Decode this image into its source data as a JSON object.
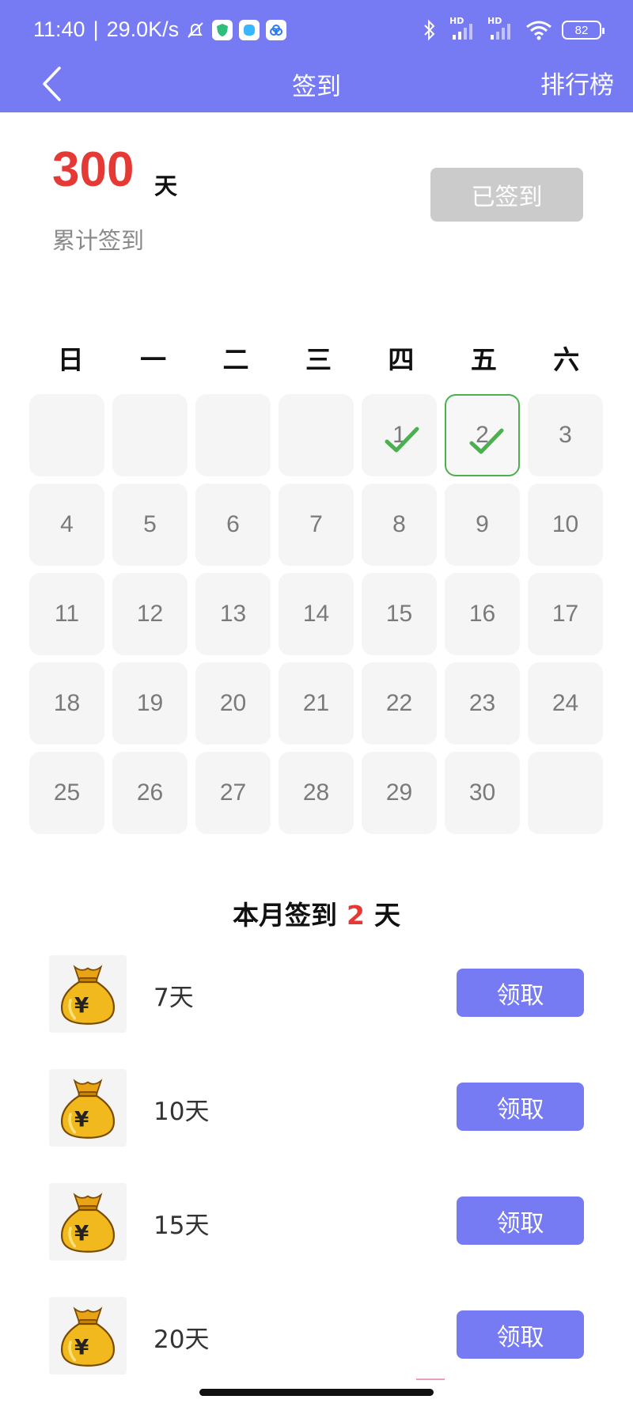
{
  "status_bar": {
    "time": "11:40",
    "separator": "|",
    "net_speed": "29.0K/s",
    "icons": [
      "bell-muted-icon",
      "shield-app-icon",
      "chat-app-icon",
      "cloud-app-icon",
      "bluetooth-icon",
      "signal-hd-icon",
      "signal-hd-icon",
      "wifi-icon"
    ],
    "hd1": "HD",
    "hd2": "HD",
    "battery": "82"
  },
  "nav": {
    "back_icon": "chevron-left-icon",
    "title": "签到",
    "ranking": "排行榜"
  },
  "summary": {
    "total_days": "300",
    "unit": "天",
    "label": "累计签到",
    "signed_button": "已签到"
  },
  "calendar": {
    "weekdays": [
      "日",
      "一",
      "二",
      "三",
      "四",
      "五",
      "六"
    ],
    "days": [
      "",
      "",
      "",
      "",
      "1",
      "2",
      "3",
      "4",
      "5",
      "6",
      "7",
      "8",
      "9",
      "10",
      "11",
      "12",
      "13",
      "14",
      "15",
      "16",
      "17",
      "18",
      "19",
      "20",
      "21",
      "22",
      "23",
      "24",
      "25",
      "26",
      "27",
      "28",
      "29",
      "30",
      ""
    ],
    "checked_days": [
      "1",
      "2"
    ],
    "today": "2",
    "check_color": "#4caf50"
  },
  "month_summary": {
    "prefix": "本月签到",
    "count": "2",
    "suffix": "天"
  },
  "rewards": [
    {
      "icon": "money-bag-icon",
      "label": "7天",
      "button": "领取"
    },
    {
      "icon": "money-bag-icon",
      "label": "10天",
      "button": "领取"
    },
    {
      "icon": "money-bag-icon",
      "label": "15天",
      "button": "领取"
    },
    {
      "icon": "money-bag-icon",
      "label": "20天",
      "button": "领取"
    }
  ],
  "colors": {
    "accent": "#767bf4",
    "highlight": "#e53935",
    "disabled": "#cbcbcb",
    "cell_bg": "#f5f5f5"
  }
}
